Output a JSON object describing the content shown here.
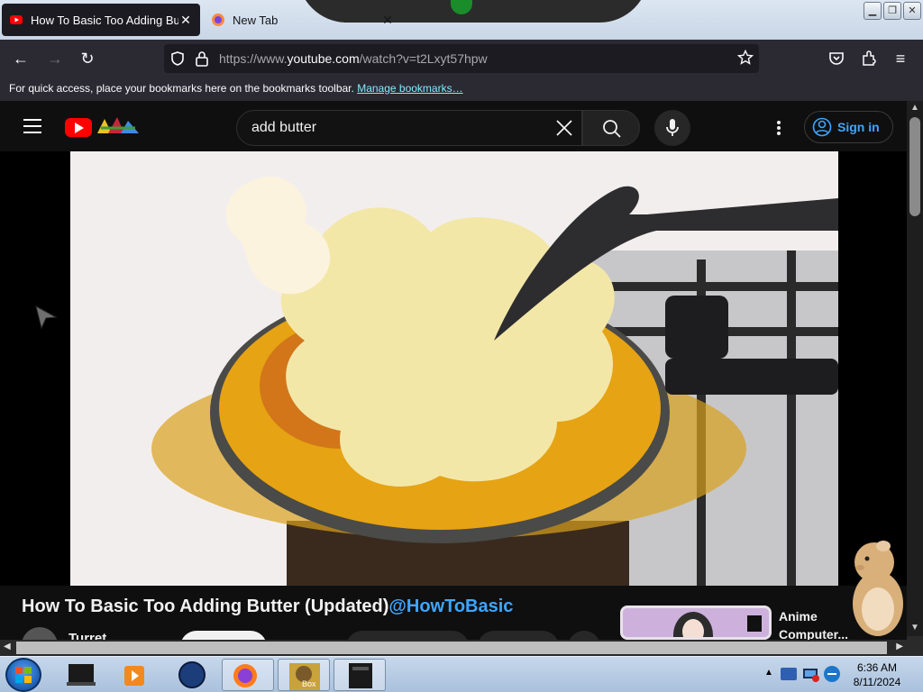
{
  "browser": {
    "tabs": [
      {
        "title": "How To Basic Too Adding Butte",
        "close": "✕"
      },
      {
        "title": "New Tab",
        "close": "✕"
      }
    ],
    "url_prefix": "https://www.",
    "url_domain": "youtube.com",
    "url_suffix": "/watch?v=t2Lxyt57hpw",
    "bookmarks_text": "For quick access, place your bookmarks here on the bookmarks toolbar.",
    "bookmarks_link": "Manage bookmarks…"
  },
  "youtube": {
    "search_query": "add butter",
    "sign_in": "Sign in",
    "video_title": "How To Basic Too Adding Butter (Updated)",
    "video_handle": "@HowToBasic",
    "channel_name": "Turret",
    "related_title_line1": "Anime",
    "related_title_line2": "Computer..."
  },
  "taskbar": {
    "time": "6:36 AM",
    "date": "8/11/2024",
    "box_label": "Box"
  },
  "colors": {
    "youtube_red": "#ff0000",
    "link_blue": "#3ea6ff"
  }
}
